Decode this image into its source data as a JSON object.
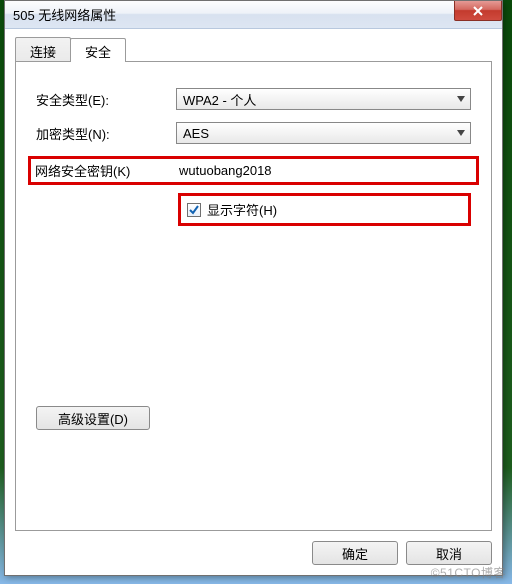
{
  "window": {
    "title": "505 无线网络属性"
  },
  "tabs": {
    "connect": "连接",
    "security": "安全"
  },
  "fields": {
    "security_type_label": "安全类型(E):",
    "security_type_value": "WPA2 - 个人",
    "encryption_label": "加密类型(N):",
    "encryption_value": "AES",
    "key_label": "网络安全密钥(K)",
    "key_value": "wutuobang2018",
    "show_chars_label": "显示字符(H)"
  },
  "buttons": {
    "advanced": "高级设置(D)",
    "ok": "确定",
    "cancel": "取消"
  },
  "watermark": "©51CTO博客"
}
